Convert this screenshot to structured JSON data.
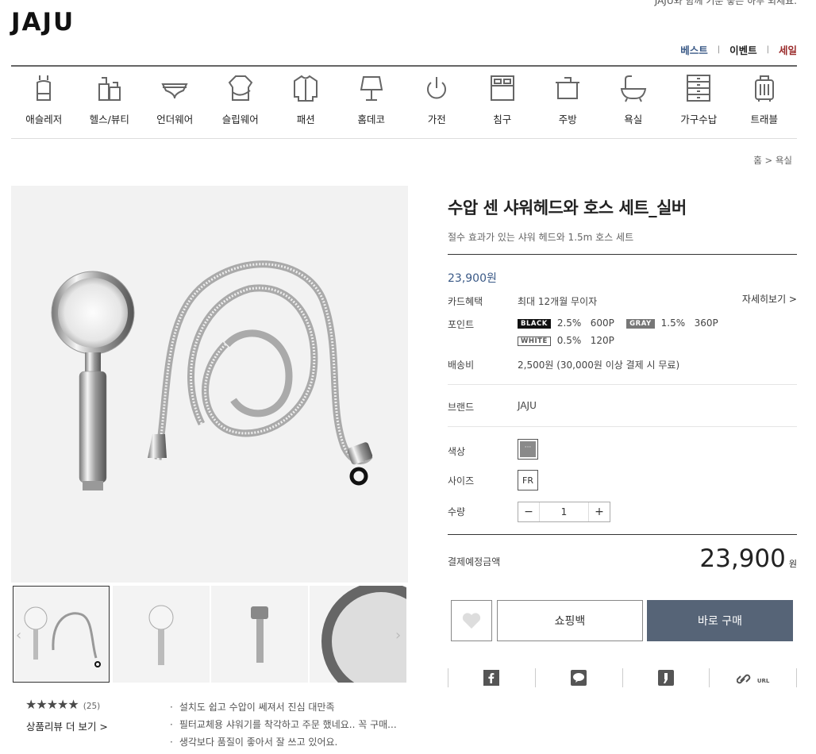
{
  "header": {
    "tagline": "JAJU와 함께 기분 좋은 하루 되세요.",
    "logo": "JAJU",
    "nav": [
      {
        "label": "베스트",
        "color": "#3b5a87"
      },
      {
        "label": "이벤트",
        "color": "#222222"
      },
      {
        "label": "세일",
        "color": "#9b2c2c"
      }
    ],
    "nav_sep": "|"
  },
  "categories": [
    {
      "label": "애슬레저",
      "icon": "athleisure-icon"
    },
    {
      "label": "헬스/뷰티",
      "icon": "beauty-icon"
    },
    {
      "label": "언더웨어",
      "icon": "underwear-icon"
    },
    {
      "label": "슬립웨어",
      "icon": "sleepwear-icon"
    },
    {
      "label": "패션",
      "icon": "fashion-icon"
    },
    {
      "label": "홈데코",
      "icon": "lamp-icon"
    },
    {
      "label": "가전",
      "icon": "power-icon"
    },
    {
      "label": "침구",
      "icon": "bedding-icon"
    },
    {
      "label": "주방",
      "icon": "pot-icon"
    },
    {
      "label": "욕실",
      "icon": "bathtub-icon"
    },
    {
      "label": "가구수납",
      "icon": "drawer-icon"
    },
    {
      "label": "트래블",
      "icon": "luggage-icon"
    }
  ],
  "breadcrumb": {
    "home": "홈",
    "sep": ">",
    "current": "욕실"
  },
  "product": {
    "title": "수압 센 샤워헤드와 호스 세트_실버",
    "subtitle": "절수 효과가 있는 샤워 헤드와 1.5m 호스 세트",
    "price": "23,900원",
    "card_label": "카드혜택",
    "card_value": "최대 12개월 무이자",
    "detail_link": "자세히보기 >",
    "points_label": "포인트",
    "points": [
      {
        "badge": "BLACK",
        "rate": "2.5%",
        "points": "600P"
      },
      {
        "badge": "GRAY",
        "rate": "1.5%",
        "points": "360P"
      },
      {
        "badge": "WHITE",
        "rate": "0.5%",
        "points": "120P"
      }
    ],
    "shipping_label": "배송비",
    "shipping_value": "2,500원 (30,000원 이상 결제 시 무료)",
    "brand_label": "브랜드",
    "brand_value": "JAJU",
    "color_label": "색상",
    "size_label": "사이즈",
    "size_value": "FR",
    "qty_label": "수량",
    "qty_minus": "−",
    "qty_value": "1",
    "qty_plus": "+",
    "total_label": "결제예정금액",
    "total_value": "23,900",
    "total_unit": "원",
    "bag_button": "쇼핑백",
    "buy_button": "바로 구매",
    "share_url_label": "URL"
  },
  "reviews": {
    "stars": "★★★★★",
    "count": "(25)",
    "more": "상품리뷰 더 보기 >",
    "snippets": [
      "설치도 쉽고 수압이 쎄져서 진심 대만족",
      "필터교체용 샤워기를 착각하고 주문 했네요.. 꼭 구매...",
      "생각보다 품질이 좋아서 잘 쓰고 있어요."
    ]
  },
  "colors": {
    "accent": "#566477",
    "price": "#3b5a87",
    "sale": "#9b2c2c"
  }
}
